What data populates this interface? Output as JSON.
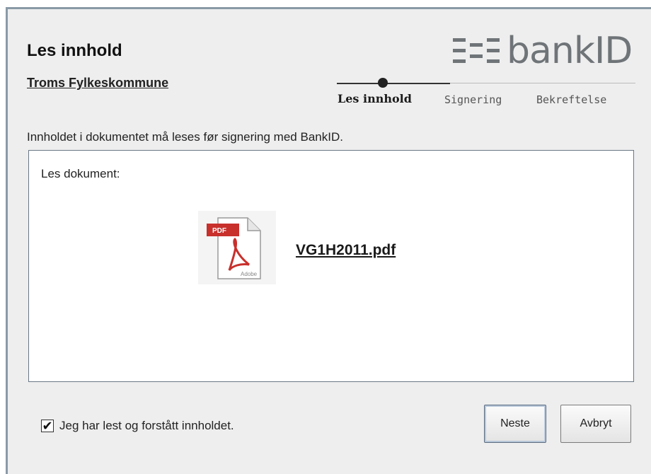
{
  "header": {
    "title": "Les innhold",
    "subtitle": "Troms Fylkeskommune"
  },
  "logo": {
    "text": "bankID",
    "icon": "bankid-logo-mark"
  },
  "steps": [
    {
      "label": "Les innhold",
      "active": true
    },
    {
      "label": "Signering",
      "active": false
    },
    {
      "label": "Bekreftelse",
      "active": false
    }
  ],
  "instruction": "Innholdet i dokumentet må leses før signering med BankID.",
  "document": {
    "label": "Les dokument:",
    "file_name": "VG1H2011.pdf",
    "icon": "pdf-icon",
    "icon_badge": "PDF",
    "icon_brand": "Adobe"
  },
  "confirm": {
    "checked": true,
    "label": "Jeg har lest og forstått innholdet."
  },
  "buttons": {
    "next": "Neste",
    "cancel": "Avbryt"
  },
  "colors": {
    "background": "#eeeeee",
    "border": "#8a9aa6",
    "pdf_red": "#c8302c"
  }
}
